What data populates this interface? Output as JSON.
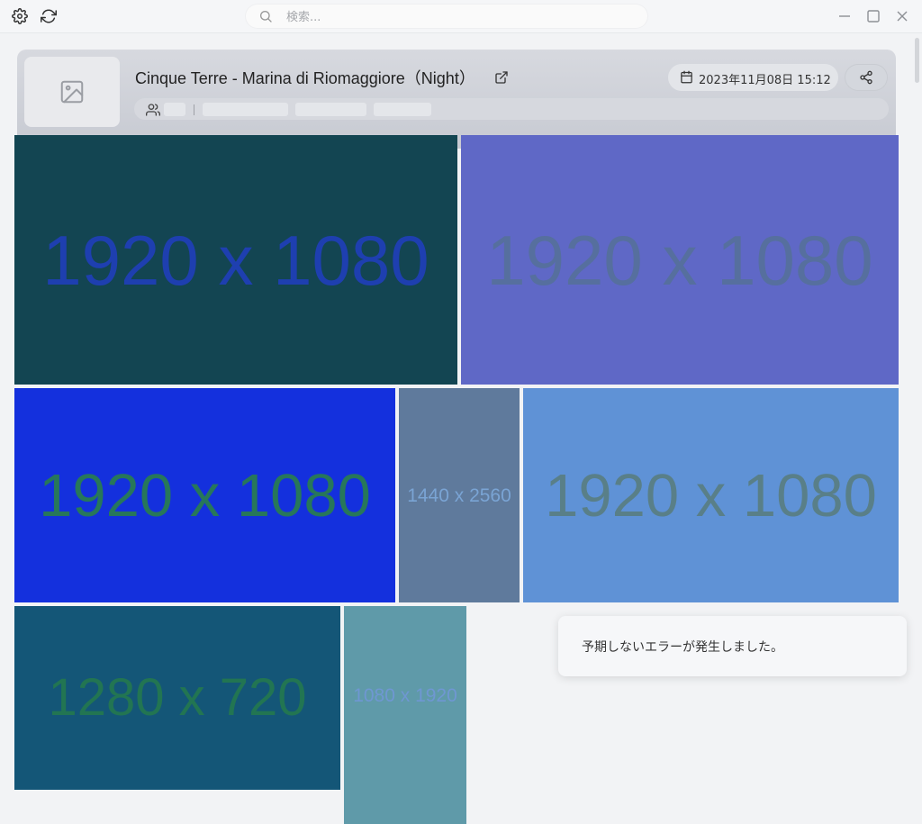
{
  "toolbar": {
    "settings_icon": "gear-icon",
    "refresh_icon": "refresh-icon"
  },
  "search": {
    "placeholder": "検索...",
    "value": ""
  },
  "window_controls": [
    "minimize-icon",
    "maximize-icon",
    "close-icon"
  ],
  "album": {
    "title": "Cinque Terre - Marina di Riomaggiore（Night）",
    "date": "2023年11月08日 15:12",
    "thumbnail_icon": "image-icon",
    "members_icon": "users-icon"
  },
  "photos": [
    {
      "label": "1920 x 1080",
      "bg": "#134552",
      "fg": "#1e3fb0"
    },
    {
      "label": "1920 x 1080",
      "bg": "#5f68c6",
      "fg": "#566f9e"
    },
    {
      "label": "1920 x 1080",
      "bg": "#1430dd",
      "fg": "#27775a"
    },
    {
      "label": "1440 x 2560",
      "bg": "#5f7a9c",
      "fg": "#7aa4d4"
    },
    {
      "label": "1920 x 1080",
      "bg": "#5f92d6",
      "fg": "#597f88"
    },
    {
      "label": "1280 x 720",
      "bg": "#145677",
      "fg": "#227552"
    },
    {
      "label": "1080 x 1920",
      "bg": "#5f9aa9",
      "fg": "#6f97d2"
    }
  ],
  "toast": {
    "message": "予期しないエラーが発生しました。"
  }
}
